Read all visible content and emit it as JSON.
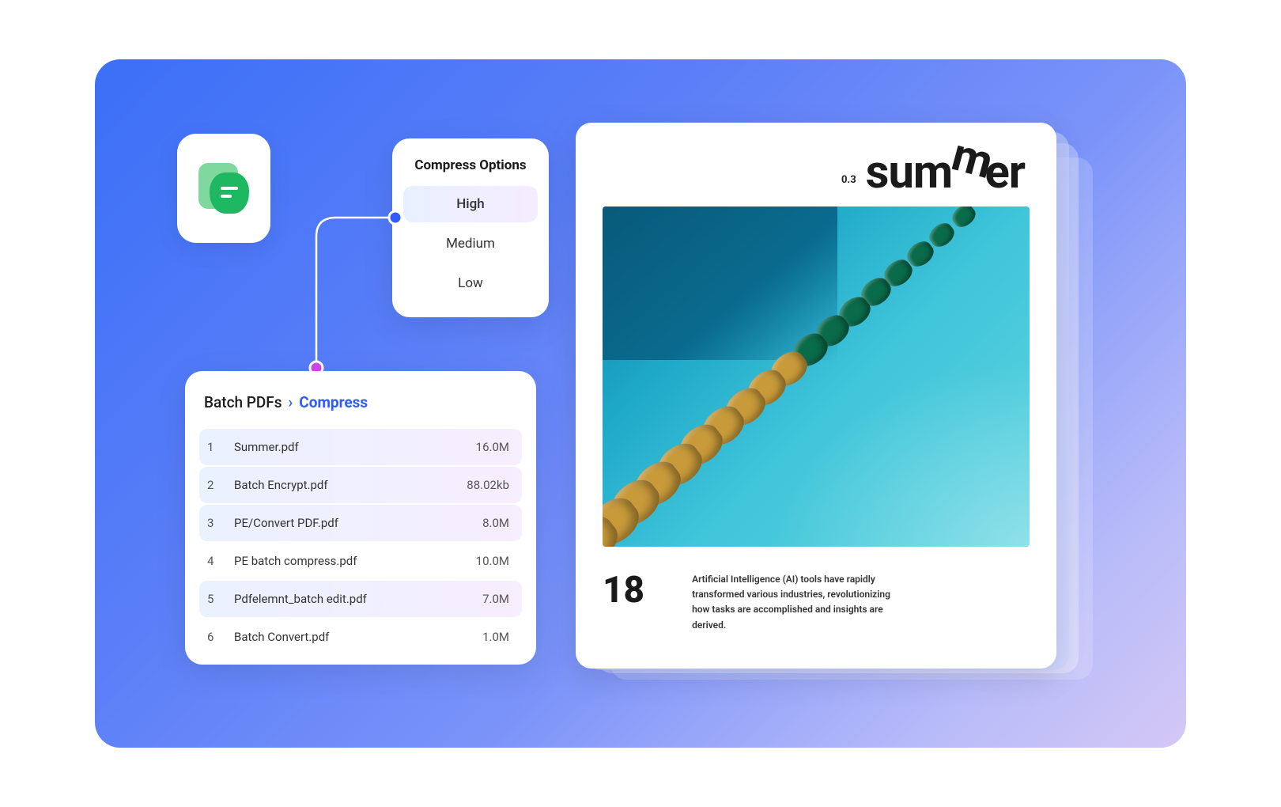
{
  "compress": {
    "title": "Compress Options",
    "options": [
      "High",
      "Medium",
      "Low"
    ],
    "selected_index": 0
  },
  "files": {
    "breadcrumb_root": "Batch PDFs",
    "breadcrumb_current": "Compress",
    "list": [
      {
        "idx": "1",
        "name": "Summer.pdf",
        "size": "16.0M"
      },
      {
        "idx": "2",
        "name": "Batch Encrypt.pdf",
        "size": "88.02kb"
      },
      {
        "idx": "3",
        "name": "PE/Convert PDF.pdf",
        "size": "8.0M"
      },
      {
        "idx": "4",
        "name": "PE batch compress.pdf",
        "size": "10.0M"
      },
      {
        "idx": "5",
        "name": "Pdfelemnt_batch edit.pdf",
        "size": "7.0M"
      },
      {
        "idx": "6",
        "name": "Batch Convert.pdf",
        "size": "1.0M"
      }
    ]
  },
  "document": {
    "version": "0.3",
    "title_part1": "sum",
    "title_m": "m",
    "title_part2": "er",
    "page_number": "18",
    "body": "Artificial Intelligence (AI) tools have rapidly transformed various industries, revolutionizing how tasks are accomplished and insights are derived."
  }
}
